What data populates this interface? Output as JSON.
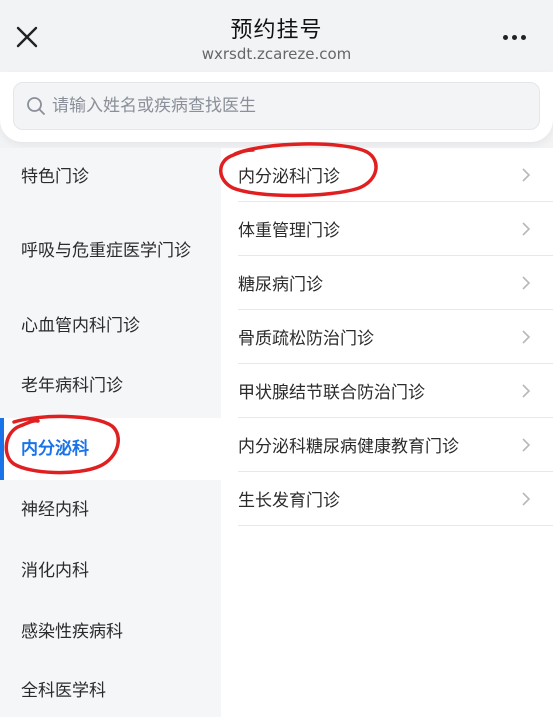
{
  "header": {
    "title": "预约挂号",
    "url": "wxrsdt.zcareze.com",
    "close_icon": "close-icon",
    "more_icon": "more-icon"
  },
  "search": {
    "placeholder": "请输入姓名或疾病查找医生",
    "value": ""
  },
  "sidebar": {
    "items": [
      {
        "label": "特色门诊"
      },
      {
        "label": "呼吸与危重症医学门诊"
      },
      {
        "label": "心血管内科门诊"
      },
      {
        "label": "老年病科门诊"
      },
      {
        "label": "内分泌科",
        "active": true
      },
      {
        "label": "神经内科"
      },
      {
        "label": "消化内科"
      },
      {
        "label": "感染性疾病科"
      },
      {
        "label": "全科医学科"
      }
    ]
  },
  "clinics": {
    "items": [
      {
        "label": "内分泌科门诊"
      },
      {
        "label": "体重管理门诊"
      },
      {
        "label": "糖尿病门诊"
      },
      {
        "label": "骨质疏松防治门诊"
      },
      {
        "label": "甲状腺结节联合防治门诊"
      },
      {
        "label": "内分泌科糖尿病健康教育门诊"
      },
      {
        "label": "生长发育门诊"
      }
    ]
  },
  "colors": {
    "accent": "#1a73e8",
    "annotation": "#e02020"
  }
}
